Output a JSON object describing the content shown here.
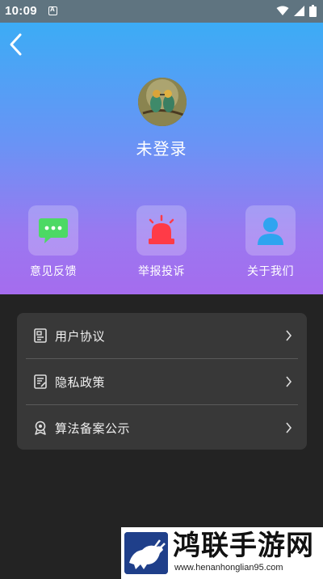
{
  "status_bar": {
    "time": "10:09",
    "icons": [
      "a-notification-icon",
      "wifi-icon",
      "signal-icon",
      "battery-icon"
    ]
  },
  "header": {
    "back_icon": "chevron-left-icon",
    "avatar_icon": "birds-avatar-image",
    "login_text": "未登录"
  },
  "quick_actions": [
    {
      "label": "意见反馈",
      "icon": "chat-bubble-icon",
      "color": "#4cd964"
    },
    {
      "label": "举报投诉",
      "icon": "alarm-siren-icon",
      "color": "#ff3b47"
    },
    {
      "label": "关于我们",
      "icon": "person-icon",
      "color": "#2fa4f0"
    }
  ],
  "menu": [
    {
      "label": "用户协议",
      "icon": "document-icon"
    },
    {
      "label": "隐私政策",
      "icon": "privacy-document-icon"
    },
    {
      "label": "算法备案公示",
      "icon": "badge-ribbon-icon"
    }
  ],
  "watermark": {
    "title": "鸿联手游网",
    "url": "www.henanhonglian95.com"
  },
  "colors": {
    "gradient_top": "#3cacf5",
    "gradient_bottom": "#a56cee",
    "page_bg": "#232323",
    "card_bg": "#383838"
  }
}
